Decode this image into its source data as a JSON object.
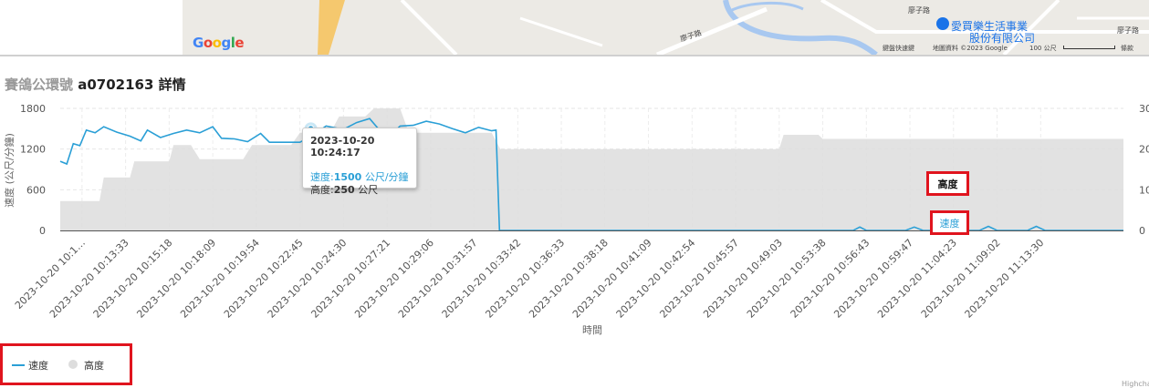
{
  "map": {
    "logo": "Google",
    "road_labels": [
      "廖子路",
      "廖子路",
      "廖子路"
    ],
    "poi_name_line1": "愛買樂生活事業",
    "poi_name_line2": "股份有限公司",
    "shortcut_text": "鍵盤快速鍵",
    "map_data_text": "地圖資料 ©2023 Google",
    "scale_text": "100 公尺",
    "terms_text": "條款",
    "road_color": "#f5c86e",
    "river_color": "#a8c8f0",
    "land_color": "#eceae5"
  },
  "page": {
    "title_prefix": "賽鴿公環號",
    "title_id": "a0702163 詳情"
  },
  "chart_data": {
    "type": "line",
    "xlabel": "時間",
    "ylabel_left": "速度 (公尺/分鐘)",
    "yticks_left": [
      "0",
      "600",
      "1200",
      "1800"
    ],
    "ylim_left": [
      0,
      1800
    ],
    "yticks_right": [
      "0",
      "10",
      "20",
      "30"
    ],
    "ylim_right": [
      0,
      30
    ],
    "grid": "dashed",
    "legend_position": "bottom-left",
    "x_tick_labels": [
      "2023-10-20 10:1…",
      "2023-10-20 10:13:33",
      "2023-10-20 10:15:18",
      "2023-10-20 10:18:09",
      "2023-10-20 10:19:54",
      "2023-10-20 10:22:45",
      "2023-10-20 10:24:30",
      "2023-10-20 10:27:21",
      "2023-10-20 10:29:06",
      "2023-10-20 10:31:57",
      "2023-10-20 10:33:42",
      "2023-10-20 10:36:33",
      "2023-10-20 10:38:18",
      "2023-10-20 10:41:09",
      "2023-10-20 10:42:54",
      "2023-10-20 10:45:57",
      "2023-10-20 10:49:03",
      "2023-10-20 10:53:38",
      "2023-10-20 10:56:43",
      "2023-10-20 10:59:47",
      "2023-10-20 11:04:23",
      "2023-10-20 11:09:02",
      "2023-10-20 11:13:30"
    ],
    "series": [
      {
        "name": "速度",
        "color": "#2a9fd6",
        "axis": "left",
        "points": [
          [
            0,
            1020
          ],
          [
            0.15,
            980
          ],
          [
            0.3,
            1280
          ],
          [
            0.45,
            1250
          ],
          [
            0.6,
            1480
          ],
          [
            0.8,
            1440
          ],
          [
            1.0,
            1530
          ],
          [
            1.3,
            1450
          ],
          [
            1.6,
            1390
          ],
          [
            1.85,
            1320
          ],
          [
            2.0,
            1480
          ],
          [
            2.3,
            1370
          ],
          [
            2.6,
            1430
          ],
          [
            2.9,
            1480
          ],
          [
            3.2,
            1440
          ],
          [
            3.5,
            1530
          ],
          [
            3.7,
            1360
          ],
          [
            4.0,
            1350
          ],
          [
            4.3,
            1310
          ],
          [
            4.6,
            1430
          ],
          [
            4.8,
            1300
          ],
          [
            5.2,
            1300
          ],
          [
            5.5,
            1300
          ],
          [
            5.8,
            1400
          ],
          [
            6.1,
            1540
          ],
          [
            6.5,
            1490
          ],
          [
            6.8,
            1590
          ],
          [
            7.1,
            1650
          ],
          [
            7.5,
            1350
          ],
          [
            7.8,
            1540
          ],
          [
            8.1,
            1550
          ],
          [
            8.4,
            1610
          ],
          [
            8.7,
            1570
          ],
          [
            9.0,
            1500
          ],
          [
            9.3,
            1440
          ],
          [
            9.6,
            1520
          ],
          [
            9.9,
            1470
          ],
          [
            10.0,
            1480
          ],
          [
            10.08,
            0
          ],
          [
            18.2,
            0
          ],
          [
            18.35,
            50
          ],
          [
            18.5,
            0
          ],
          [
            19.4,
            0
          ],
          [
            19.6,
            50
          ],
          [
            19.8,
            0
          ],
          [
            21.1,
            0
          ],
          [
            21.3,
            60
          ],
          [
            21.5,
            0
          ],
          [
            22.2,
            0
          ],
          [
            22.4,
            60
          ],
          [
            22.6,
            0
          ],
          [
            24.4,
            0
          ]
        ]
      },
      {
        "name": "高度",
        "color": "#dddddd",
        "axis": "right",
        "points": [
          [
            0,
            7.2
          ],
          [
            0.9,
            7.2
          ],
          [
            1.0,
            13
          ],
          [
            1.6,
            13
          ],
          [
            1.7,
            17
          ],
          [
            2.5,
            17
          ],
          [
            2.6,
            21
          ],
          [
            3.0,
            21
          ],
          [
            3.2,
            17.5
          ],
          [
            4.2,
            17.5
          ],
          [
            4.4,
            21
          ],
          [
            5.3,
            21
          ],
          [
            5.5,
            24
          ],
          [
            6.2,
            24
          ],
          [
            6.4,
            28
          ],
          [
            7.0,
            28
          ],
          [
            7.2,
            30
          ],
          [
            7.8,
            30
          ],
          [
            8.0,
            24
          ],
          [
            9.9,
            24
          ],
          [
            10.1,
            20
          ],
          [
            16.5,
            20
          ],
          [
            16.6,
            23.5
          ],
          [
            17.4,
            23.5
          ],
          [
            17.5,
            22.5
          ],
          [
            24.4,
            22.5
          ]
        ]
      }
    ],
    "tooltip": {
      "time": "2023-10-20 10:24:17",
      "speed_name": "速度:",
      "speed_value": "1500",
      "speed_unit": " 公尺/分鐘",
      "height_name": "高度:",
      "height_value": "250",
      "height_unit": " 公尺"
    },
    "series_labels": {
      "height": "高度",
      "speed": "速度"
    },
    "legend": [
      {
        "name": "速度"
      },
      {
        "name": "高度"
      }
    ],
    "credit": "Highcharts"
  }
}
